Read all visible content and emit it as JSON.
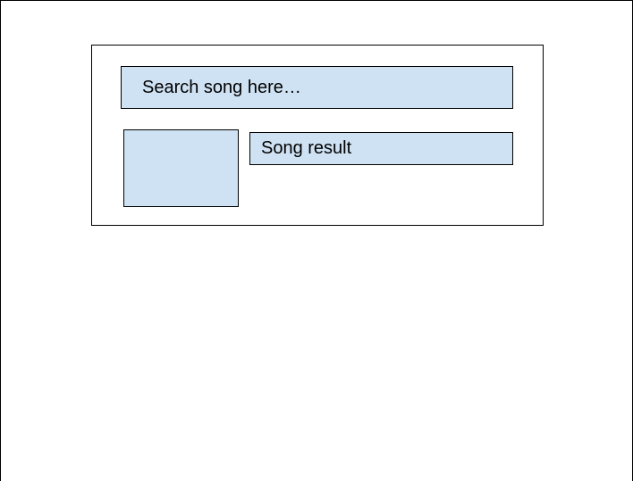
{
  "search": {
    "placeholder": "Search song here…"
  },
  "result": {
    "title": "Song result"
  },
  "colors": {
    "fill": "#cfe2f3",
    "stroke": "#000000",
    "background": "#ffffff"
  }
}
